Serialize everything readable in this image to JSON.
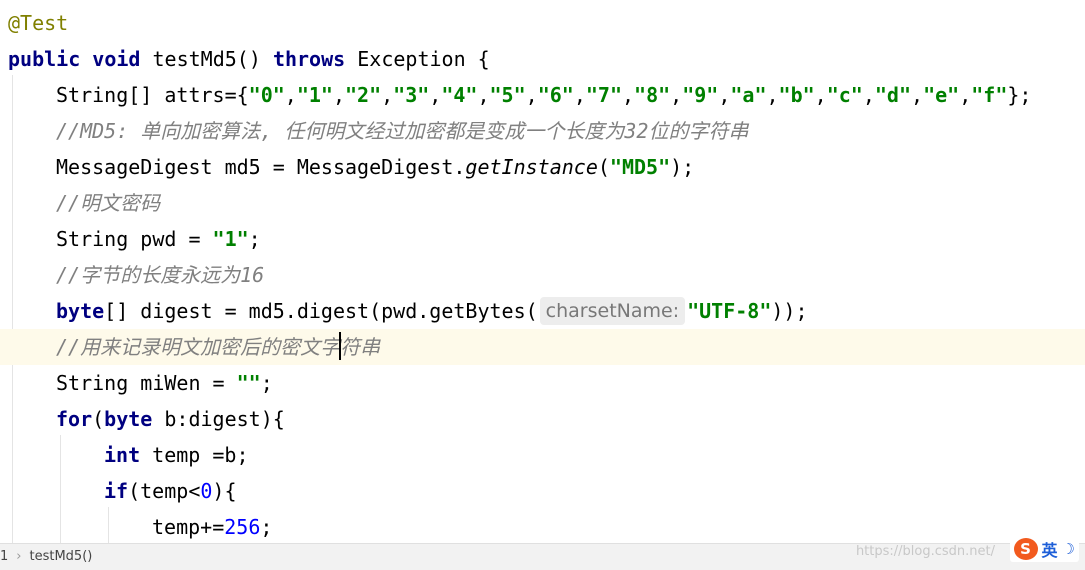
{
  "editor": {
    "annotation": "@Test",
    "method_signature": {
      "kw_public": "public",
      "kw_void": "void",
      "method_name": "testMd5()",
      "kw_throws": "throws",
      "exception": "Exception",
      "brace": "{"
    },
    "attrs_line": {
      "decl": "String[] attrs={",
      "values": [
        "0",
        "1",
        "2",
        "3",
        "4",
        "5",
        "6",
        "7",
        "8",
        "9",
        "a",
        "b",
        "c",
        "d",
        "e",
        "f"
      ],
      "end": "};"
    },
    "comment_md5": "//MD5: 单向加密算法, 任何明文经过加密都是变成一个长度为32位的字符串",
    "md5_line": {
      "prefix": "MessageDigest md5 = MessageDigest.",
      "method": "getInstance",
      "open": "(",
      "arg": "\"MD5\"",
      "close": ");"
    },
    "comment_pwd": "//明文密码",
    "pwd_line": {
      "prefix": "String pwd = ",
      "value": "\"1\"",
      "end": ";"
    },
    "comment_len": "//字节的长度永远为16",
    "digest_line": {
      "kw": "byte",
      "mid": "[] digest = md5.digest(pwd.getBytes(",
      "hint": "charsetName:",
      "arg": "\"UTF-8\"",
      "end": "));"
    },
    "comment_record_before": "//用来记录明文加密后的密文字",
    "comment_record_after": "符串",
    "miwen_line": {
      "prefix": "String miWen = ",
      "value": "\"\"",
      "end": ";"
    },
    "for_line": {
      "kw_for": "for",
      "open": "(",
      "kw_byte": "byte",
      "rest": " b:digest){"
    },
    "int_line": {
      "kw": "int",
      "rest": " temp =b;"
    },
    "if_line": {
      "kw": "if",
      "open": "(temp",
      "op": "<",
      "num": "0",
      "close": "){"
    },
    "temp_line": {
      "prefix": "temp+=",
      "num": "256",
      "end": ";"
    }
  },
  "statusbar": {
    "breadcrumb_prefix": "1",
    "breadcrumb_sep": "›",
    "breadcrumb_method": "testMd5()",
    "watermark": "https://blog.csdn.net/",
    "ime_logo": "S",
    "ime_lang": "英",
    "ime_moon": "☽"
  },
  "colors": {
    "keyword": "#000080",
    "string": "#008000",
    "comment": "#808080",
    "annotation": "#808000",
    "number": "#0000ff",
    "current_line": "#fefaea"
  }
}
